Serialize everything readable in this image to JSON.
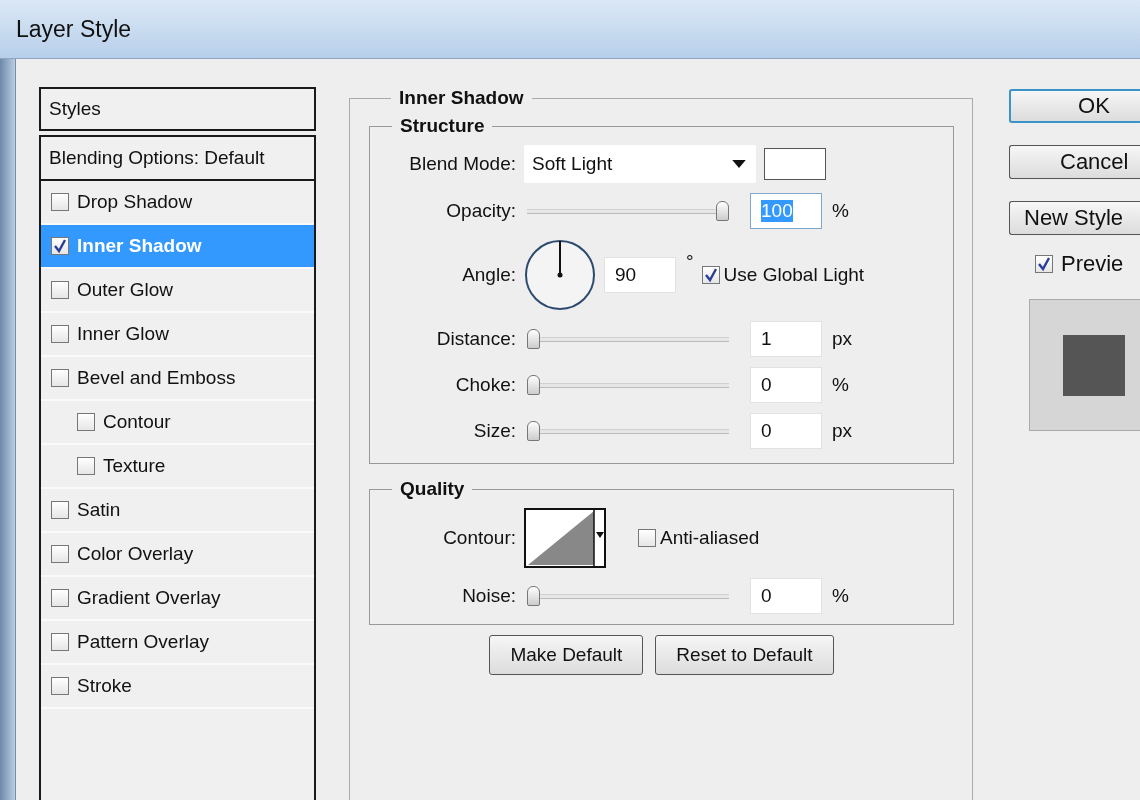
{
  "window": {
    "title": "Layer Style"
  },
  "styles": {
    "header": "Styles",
    "items": [
      {
        "label": "Blending Options: Default",
        "kind": "options"
      },
      {
        "label": "Drop Shadow",
        "kind": "effect",
        "checked": false,
        "selected": false
      },
      {
        "label": "Inner Shadow",
        "kind": "effect",
        "checked": true,
        "selected": true
      },
      {
        "label": "Outer Glow",
        "kind": "effect",
        "checked": false,
        "selected": false
      },
      {
        "label": "Inner Glow",
        "kind": "effect",
        "checked": false,
        "selected": false
      },
      {
        "label": "Bevel and Emboss",
        "kind": "effect",
        "checked": false,
        "selected": false,
        "children": [
          {
            "label": "Contour",
            "kind": "effect",
            "checked": false,
            "selected": false
          },
          {
            "label": "Texture",
            "kind": "effect",
            "checked": false,
            "selected": false
          }
        ]
      },
      {
        "label": "Satin",
        "kind": "effect",
        "checked": false,
        "selected": false
      },
      {
        "label": "Color Overlay",
        "kind": "effect",
        "checked": false,
        "selected": false
      },
      {
        "label": "Gradient Overlay",
        "kind": "effect",
        "checked": false,
        "selected": false
      },
      {
        "label": "Pattern Overlay",
        "kind": "effect",
        "checked": false,
        "selected": false
      },
      {
        "label": "Stroke",
        "kind": "effect",
        "checked": false,
        "selected": false
      }
    ]
  },
  "panel": {
    "title": "Inner Shadow",
    "structure": {
      "title": "Structure",
      "blend_mode": {
        "label": "Blend Mode:",
        "value": "Soft Light"
      },
      "opacity": {
        "label": "Opacity:",
        "level": 1,
        "value": "100",
        "unit": "%",
        "value_selected": true
      },
      "angle": {
        "label": "Angle:",
        "value": "90",
        "unit": "°",
        "global_light": {
          "label": "Use Global Light",
          "checked": true
        }
      },
      "sliders": [
        {
          "label": "Distance:",
          "level": 0,
          "value": "1",
          "unit": "px"
        },
        {
          "label": "Choke:",
          "level": 0,
          "value": "0",
          "unit": "%"
        },
        {
          "label": "Size:",
          "level": 0,
          "value": "0",
          "unit": "px"
        }
      ]
    },
    "quality": {
      "title": "Quality",
      "contour": {
        "label": "Contour:",
        "anti_aliased": {
          "label": "Anti-aliased",
          "checked": false
        }
      },
      "noise": {
        "label": "Noise:",
        "level": 0,
        "value": "0",
        "unit": "%"
      }
    },
    "buttons": [
      "Make Default",
      "Reset to Default"
    ]
  },
  "actions": {
    "buttons": [
      {
        "label": "OK",
        "default": true
      },
      {
        "label": "Cancel",
        "default": false
      },
      {
        "label": "New Style",
        "default": false
      }
    ],
    "preview": {
      "label": "Previe",
      "checked": true
    }
  }
}
